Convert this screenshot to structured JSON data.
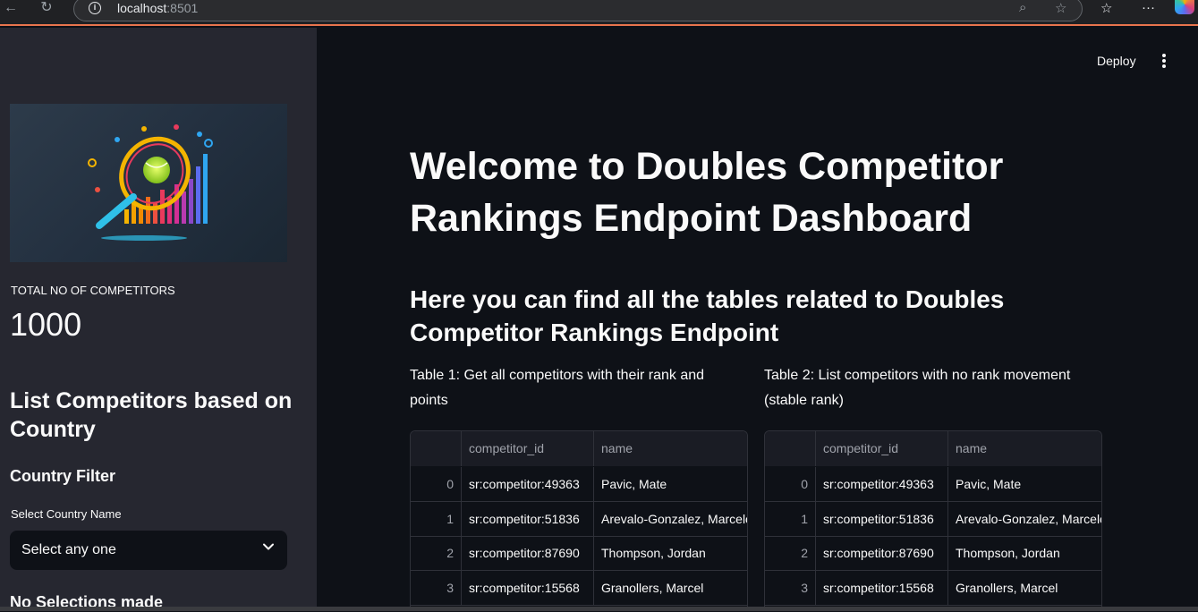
{
  "browser": {
    "url_host": "localhost",
    "url_port": ":8501"
  },
  "header": {
    "deploy_label": "Deploy"
  },
  "sidebar": {
    "metric_label": "TOTAL NO OF COMPETITORS",
    "metric_value": "1000",
    "section_title": "List Competitors based on Country",
    "filter_title": "Country Filter",
    "select_label": "Select Country Name",
    "select_value": "Select any one",
    "no_selection": "No Selections made"
  },
  "main": {
    "title": "Welcome to Doubles Competitor Rankings Endpoint Dashboard",
    "subtitle": "Here you can find all the tables related to Doubles Competitor Rankings Endpoint",
    "table1": {
      "caption": "Table 1: Get all competitors with their rank and points",
      "columns": [
        "",
        "competitor_id",
        "name"
      ],
      "rows": [
        {
          "index": "0",
          "competitor_id": "sr:competitor:49363",
          "name": "Pavic, Mate"
        },
        {
          "index": "1",
          "competitor_id": "sr:competitor:51836",
          "name": "Arevalo-Gonzalez, Marcelo"
        },
        {
          "index": "2",
          "competitor_id": "sr:competitor:87690",
          "name": "Thompson, Jordan"
        },
        {
          "index": "3",
          "competitor_id": "sr:competitor:15568",
          "name": "Granollers, Marcel"
        }
      ]
    },
    "table2": {
      "caption": "Table 2: List competitors with no rank movement (stable rank)",
      "columns": [
        "",
        "competitor_id",
        "name"
      ],
      "rows": [
        {
          "index": "0",
          "competitor_id": "sr:competitor:49363",
          "name": "Pavic, Mate"
        },
        {
          "index": "1",
          "competitor_id": "sr:competitor:51836",
          "name": "Arevalo-Gonzalez, Marcelo"
        },
        {
          "index": "2",
          "competitor_id": "sr:competitor:87690",
          "name": "Thompson, Jordan"
        },
        {
          "index": "3",
          "competitor_id": "sr:competitor:15568",
          "name": "Granollers, Marcel"
        }
      ]
    }
  },
  "colors": {
    "app_bg": "#0e1117",
    "sidebar_bg": "#262730",
    "accent_line": "#e8744d"
  }
}
